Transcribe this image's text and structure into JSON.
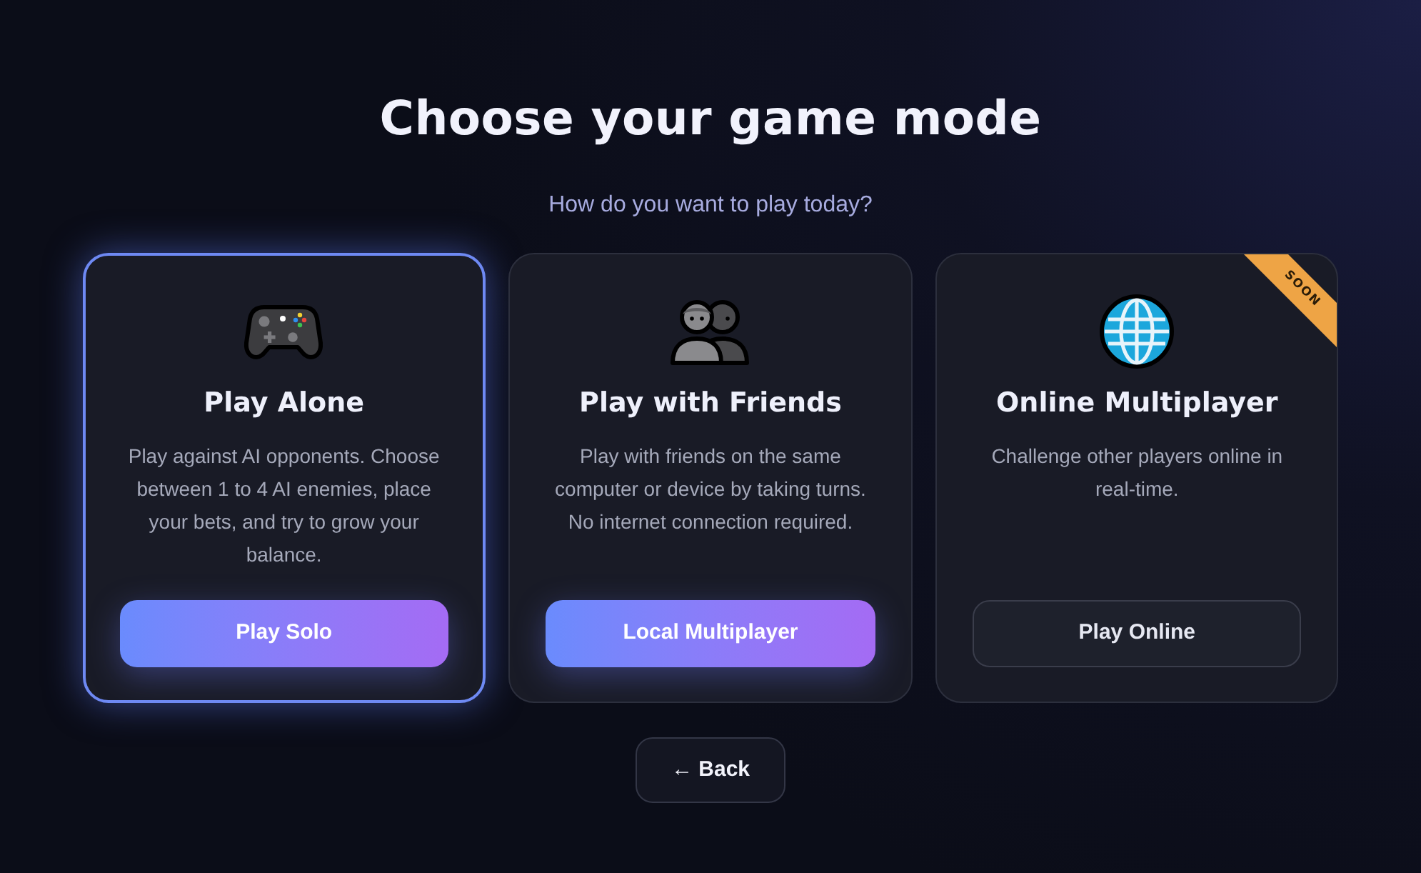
{
  "title": "Choose your game mode",
  "subtitle": "How do you want to play today?",
  "modes": [
    {
      "kind": "solo",
      "title": "Play Alone",
      "description": "Play against AI opponents. Choose between 1 to 4 AI enemies, place your bets, and try to grow your balance.",
      "button": {
        "label": "Play Solo",
        "kind": "primary"
      },
      "selected": true
    },
    {
      "kind": "local",
      "title": "Play with Friends",
      "description": "Play with friends on the same computer or device by taking turns. No internet connection required.",
      "button": {
        "label": "Local Multiplayer",
        "kind": "primary"
      },
      "selected": false
    },
    {
      "kind": "online",
      "title": "Online Multiplayer",
      "description": "Challenge other players online in real-time.",
      "button": {
        "label": "Play Online",
        "kind": "secondary"
      },
      "selected": false,
      "badge": "SOON"
    }
  ],
  "back_button": {
    "label": "← Back"
  }
}
